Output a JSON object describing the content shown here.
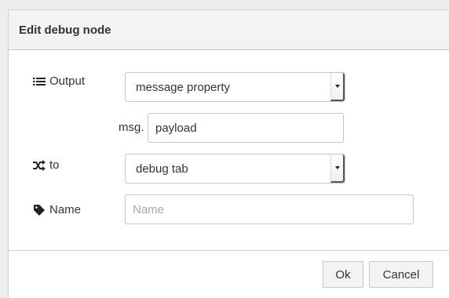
{
  "dialog": {
    "title": "Edit debug node"
  },
  "form": {
    "output": {
      "label": "Output",
      "icon": "list-icon",
      "selected": "message property"
    },
    "property": {
      "prefix": "msg.",
      "value": "payload"
    },
    "to": {
      "label": "to",
      "icon": "random-icon",
      "selected": "debug tab"
    },
    "name": {
      "label": "Name",
      "icon": "tag-icon",
      "value": "",
      "placeholder": "Name"
    }
  },
  "buttons": {
    "ok": "Ok",
    "cancel": "Cancel"
  }
}
